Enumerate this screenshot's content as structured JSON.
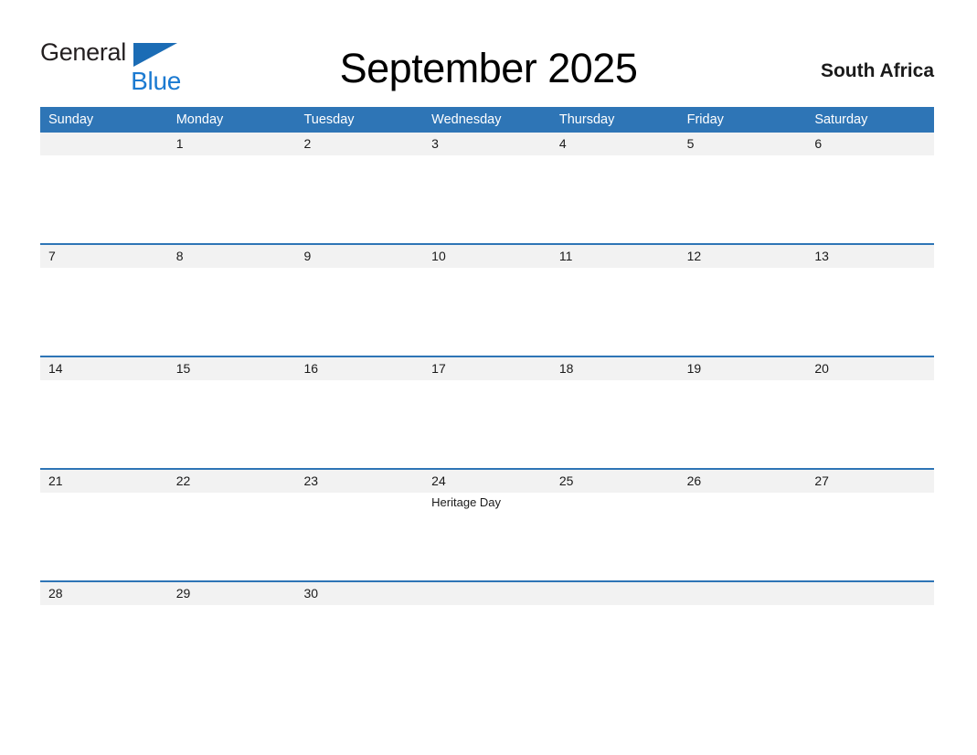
{
  "brand": {
    "logo_text_primary": "General",
    "logo_text_secondary": "Blue",
    "primary_color": "#231f20",
    "secondary_color": "#1b7ad1",
    "triangle_color": "#1b6cb5"
  },
  "header": {
    "title": "September 2025",
    "month": "September",
    "year": "2025",
    "country": "South Africa"
  },
  "theme": {
    "header_bar_color": "#2e75b6",
    "date_band_color": "#f2f2f2",
    "separator_color": "#2e75b6",
    "page_background": "#ffffff",
    "text_color": "#1a1a1a"
  },
  "calendar": {
    "weekdays": [
      "Sunday",
      "Monday",
      "Tuesday",
      "Wednesday",
      "Thursday",
      "Friday",
      "Saturday"
    ],
    "weeks": [
      {
        "days": [
          {
            "date": "",
            "event": ""
          },
          {
            "date": "1",
            "event": ""
          },
          {
            "date": "2",
            "event": ""
          },
          {
            "date": "3",
            "event": ""
          },
          {
            "date": "4",
            "event": ""
          },
          {
            "date": "5",
            "event": ""
          },
          {
            "date": "6",
            "event": ""
          }
        ]
      },
      {
        "days": [
          {
            "date": "7",
            "event": ""
          },
          {
            "date": "8",
            "event": ""
          },
          {
            "date": "9",
            "event": ""
          },
          {
            "date": "10",
            "event": ""
          },
          {
            "date": "11",
            "event": ""
          },
          {
            "date": "12",
            "event": ""
          },
          {
            "date": "13",
            "event": ""
          }
        ]
      },
      {
        "days": [
          {
            "date": "14",
            "event": ""
          },
          {
            "date": "15",
            "event": ""
          },
          {
            "date": "16",
            "event": ""
          },
          {
            "date": "17",
            "event": ""
          },
          {
            "date": "18",
            "event": ""
          },
          {
            "date": "19",
            "event": ""
          },
          {
            "date": "20",
            "event": ""
          }
        ]
      },
      {
        "days": [
          {
            "date": "21",
            "event": ""
          },
          {
            "date": "22",
            "event": ""
          },
          {
            "date": "23",
            "event": ""
          },
          {
            "date": "24",
            "event": "Heritage Day"
          },
          {
            "date": "25",
            "event": ""
          },
          {
            "date": "26",
            "event": ""
          },
          {
            "date": "27",
            "event": ""
          }
        ]
      },
      {
        "days": [
          {
            "date": "28",
            "event": ""
          },
          {
            "date": "29",
            "event": ""
          },
          {
            "date": "30",
            "event": ""
          },
          {
            "date": "",
            "event": ""
          },
          {
            "date": "",
            "event": ""
          },
          {
            "date": "",
            "event": ""
          },
          {
            "date": "",
            "event": ""
          }
        ]
      }
    ]
  }
}
